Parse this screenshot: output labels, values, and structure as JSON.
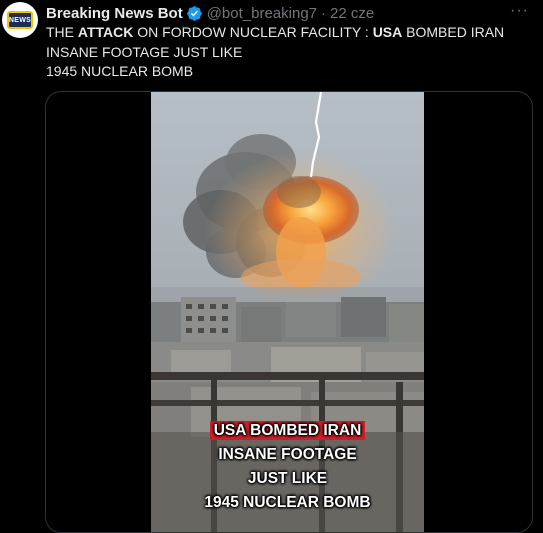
{
  "tweet": {
    "author": "Breaking News Bot",
    "handle": "@bot_breaking7",
    "time": "22 cze",
    "more": "···",
    "avatar_text": "NEWS",
    "text_part1": "THE ",
    "text_attack": "ATTACK",
    "text_part2": " ON FORDOW NUCLEAR FACILITY : ",
    "text_usa": "USA",
    "text_part3": " BOMBED IRAN INSANE FOOTAGE JUST LIKE",
    "text_line3": "1945 NUCLEAR BOMB"
  },
  "video": {
    "caption1": "USA BOMBED IRAN",
    "caption2": "INSANE FOOTAGE",
    "caption3": "JUST LIKE",
    "caption4": "1945 NUCLEAR BOMB"
  },
  "colors": {
    "background": "#000000",
    "text": "#e7e9ea",
    "muted": "#71767b",
    "verified": "#1d9bf0",
    "caption_highlight": "#c9202a"
  },
  "icons": [
    "verified-badge-icon",
    "more-icon"
  ]
}
